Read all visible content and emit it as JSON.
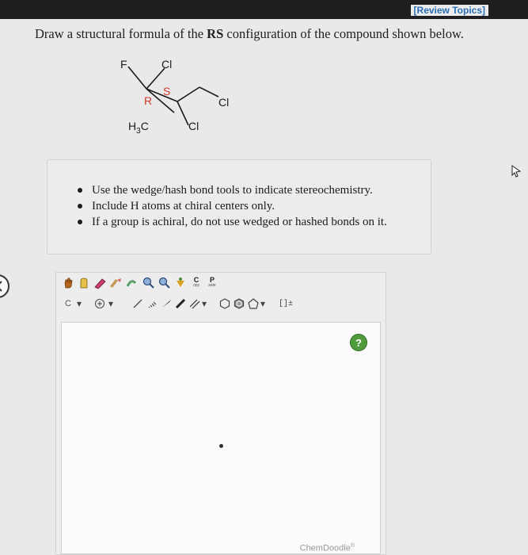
{
  "header": {
    "review_link": "[Review Topics]"
  },
  "question": {
    "prefix": "Draw a structural formula of the ",
    "emphasis": "RS",
    "suffix": " configuration of the compound shown below."
  },
  "molecule": {
    "atoms": {
      "f": "F",
      "cl_top": "Cl",
      "cl_right": "Cl",
      "cl_bottom": "Cl",
      "h3c": "H",
      "h3c_sub": "3",
      "h3c_c": "C"
    },
    "labels": {
      "r": "R",
      "s": "S"
    },
    "colors": {
      "stereo_label": "#d03a2a",
      "bond": "#1a1a1a"
    }
  },
  "hints": {
    "items": [
      "Use the wedge/hash bond tools to indicate stereochemistry.",
      "Include H atoms at chiral centers only.",
      "If a group is achiral, do not use wedged or hashed bonds on it."
    ]
  },
  "toolbar": {
    "element_label": "C",
    "copy_label": "C",
    "copy_sub": "opy",
    "paste_label": "P",
    "paste_sub": "aste",
    "bracket_label": "[]±"
  },
  "canvas": {
    "help_label": "?"
  },
  "footer": {
    "brand": "ChemDoodle",
    "brand_mark": "®"
  }
}
